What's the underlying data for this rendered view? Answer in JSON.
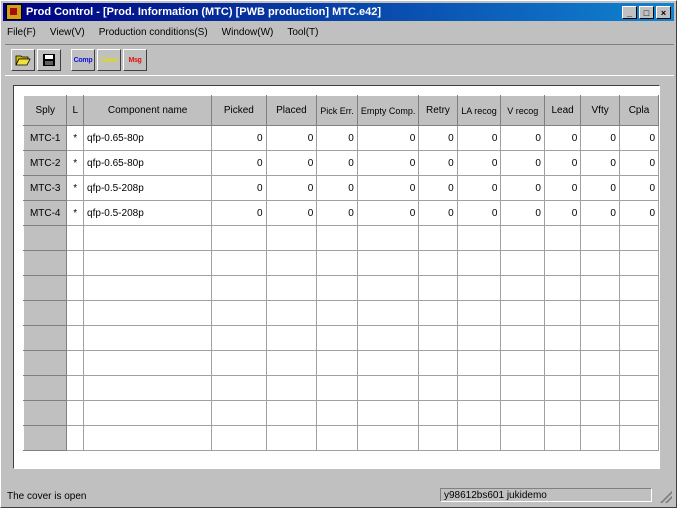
{
  "window": {
    "title": "Prod Control - [Prod. Information (MTC) [PWB production] MTC.e42]",
    "buttons": {
      "minimize": "_",
      "maximize": "□",
      "close": "×"
    }
  },
  "menu": [
    "File(F)",
    "View(V)",
    "Production conditions(S)",
    "Window(W)",
    "Tool(T)"
  ],
  "toolbar": {
    "open_icon": "folder-open-icon",
    "save_icon": "floppy-disk-icon",
    "comp_label": "Comp",
    "conv_label": "Conv",
    "msg_label": "Msg"
  },
  "table": {
    "headers": [
      "Sply",
      "L",
      "Component name",
      "Picked",
      "Placed",
      "Pick Err.",
      "Empty Comp.",
      "Retry",
      "LA recog",
      "V recog",
      "Lead",
      "Vfty",
      "Cpla"
    ],
    "rows": [
      [
        "MTC-1",
        "*",
        "qfp-0.65-80p",
        "0",
        "0",
        "0",
        "0",
        "0",
        "0",
        "0",
        "0",
        "0",
        "0"
      ],
      [
        "MTC-2",
        "*",
        "qfp-0.65-80p",
        "0",
        "0",
        "0",
        "0",
        "0",
        "0",
        "0",
        "0",
        "0",
        "0"
      ],
      [
        "MTC-3",
        "*",
        "qfp-0.5-208p",
        "0",
        "0",
        "0",
        "0",
        "0",
        "0",
        "0",
        "0",
        "0",
        "0"
      ],
      [
        "MTC-4",
        "*",
        "qfp-0.5-208p",
        "0",
        "0",
        "0",
        "0",
        "0",
        "0",
        "0",
        "0",
        "0",
        "0"
      ]
    ],
    "empty_rows": 9
  },
  "status": {
    "message": "The cover is open",
    "info": "y98612bs601  jukidemo"
  }
}
